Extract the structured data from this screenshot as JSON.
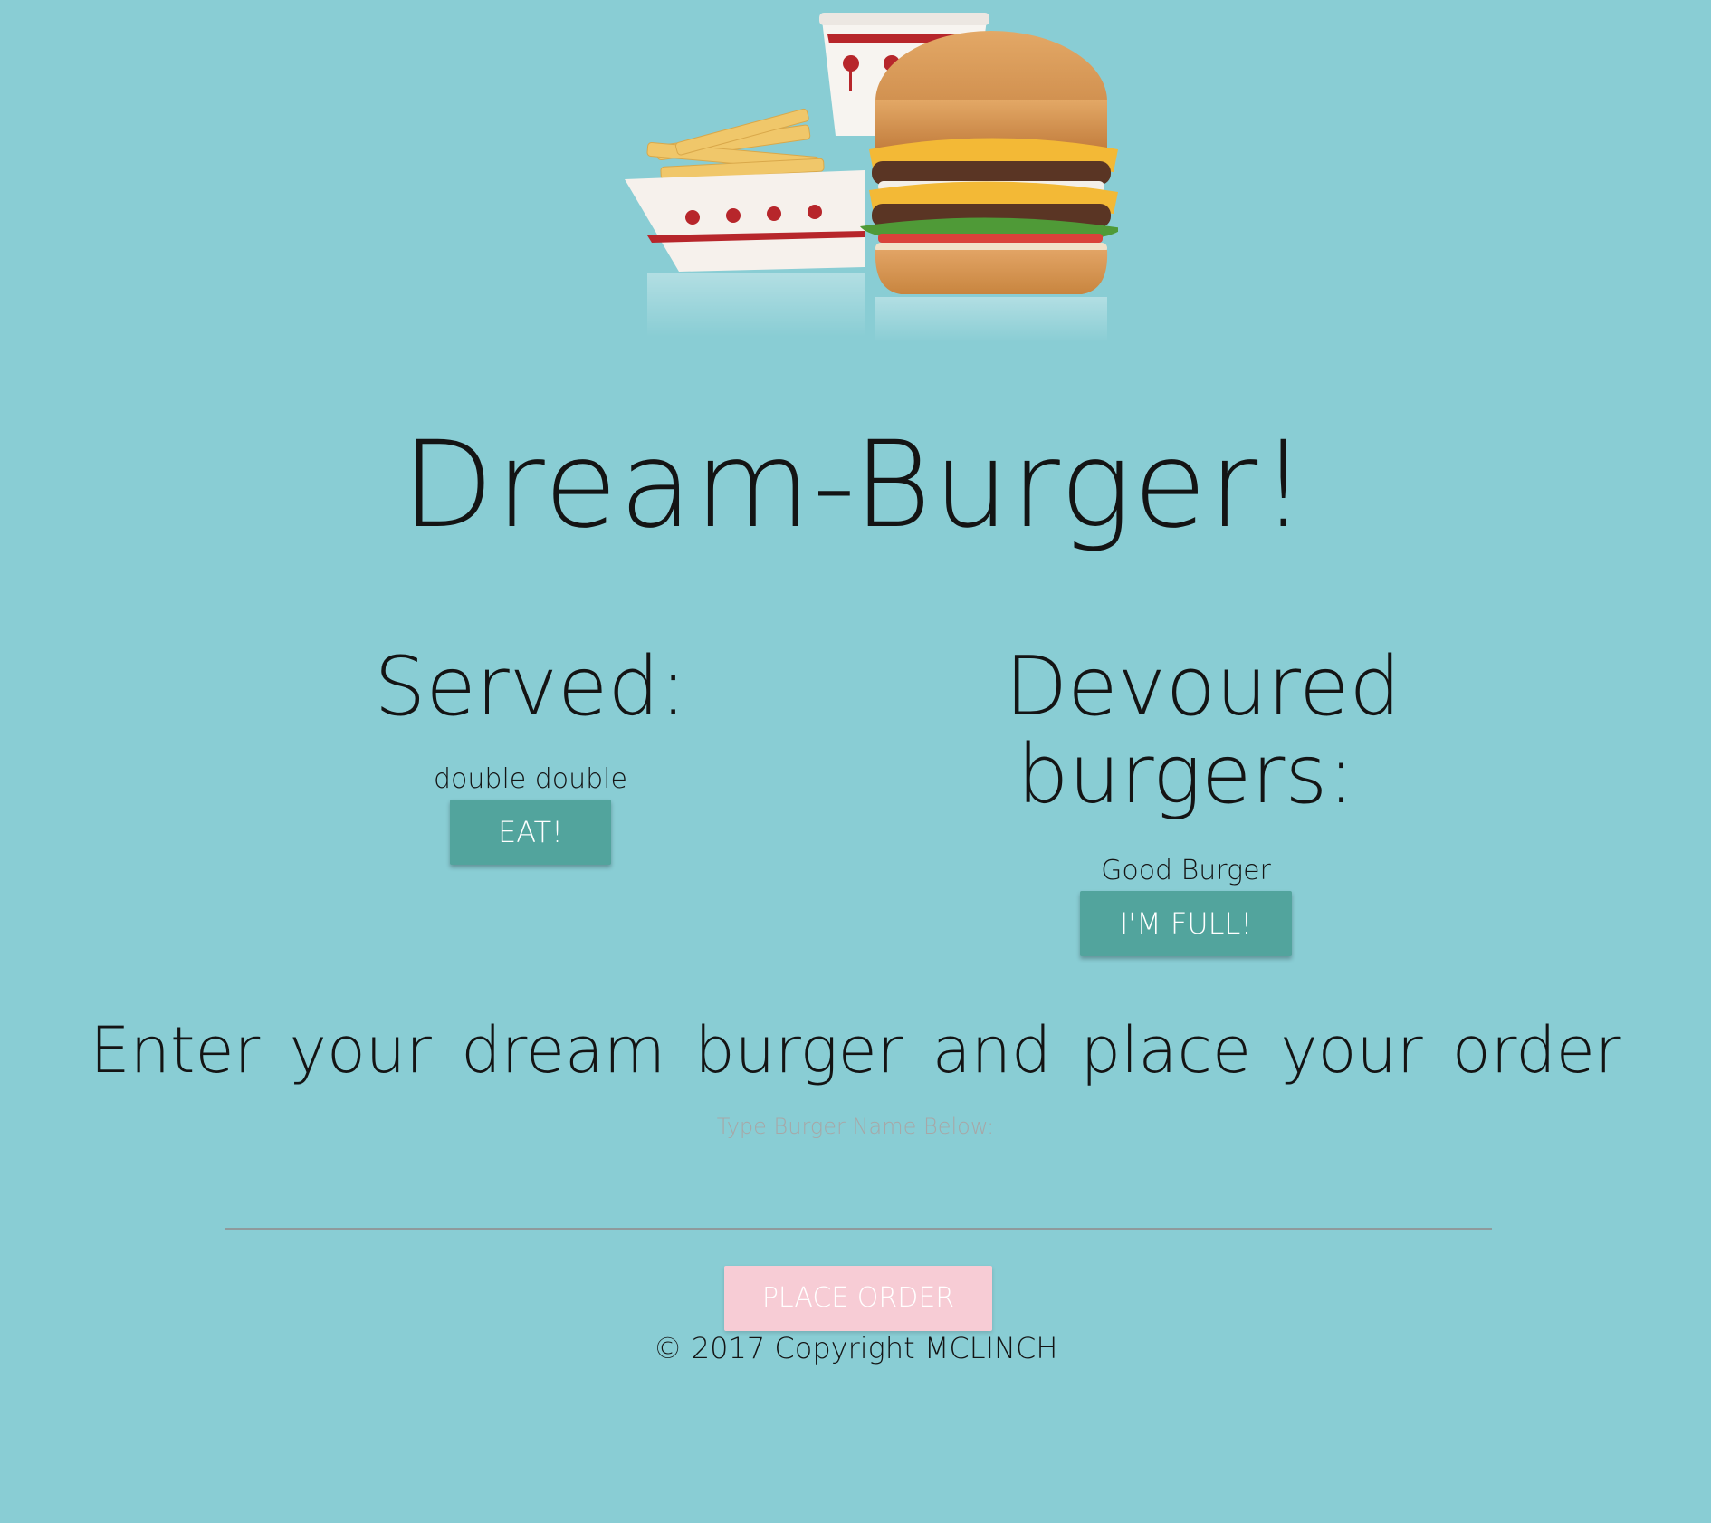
{
  "site": {
    "title": "Dream-Burger!"
  },
  "hero": {
    "image_name": "burger-fries-drink-image"
  },
  "served": {
    "heading": "Served:",
    "items": [
      {
        "name": "double double",
        "button_label": "EAT!"
      }
    ]
  },
  "devoured": {
    "heading": "Devoured burgers:",
    "items": [
      {
        "name": "Good Burger",
        "button_label": "I'M FULL!"
      }
    ]
  },
  "order_form": {
    "heading": "Enter your dream burger and place your order",
    "field_label": "Type Burger Name Below:",
    "input_value": "",
    "submit_label": "PLACE ORDER"
  },
  "footer": {
    "text": "© 2017 Copyright MCLINCH"
  },
  "colors": {
    "background": "#89cdd4",
    "button_teal": "#52a49d",
    "button_pink": "#f7ccd5",
    "text": "#141414",
    "label_gray": "#a7a7a7"
  }
}
